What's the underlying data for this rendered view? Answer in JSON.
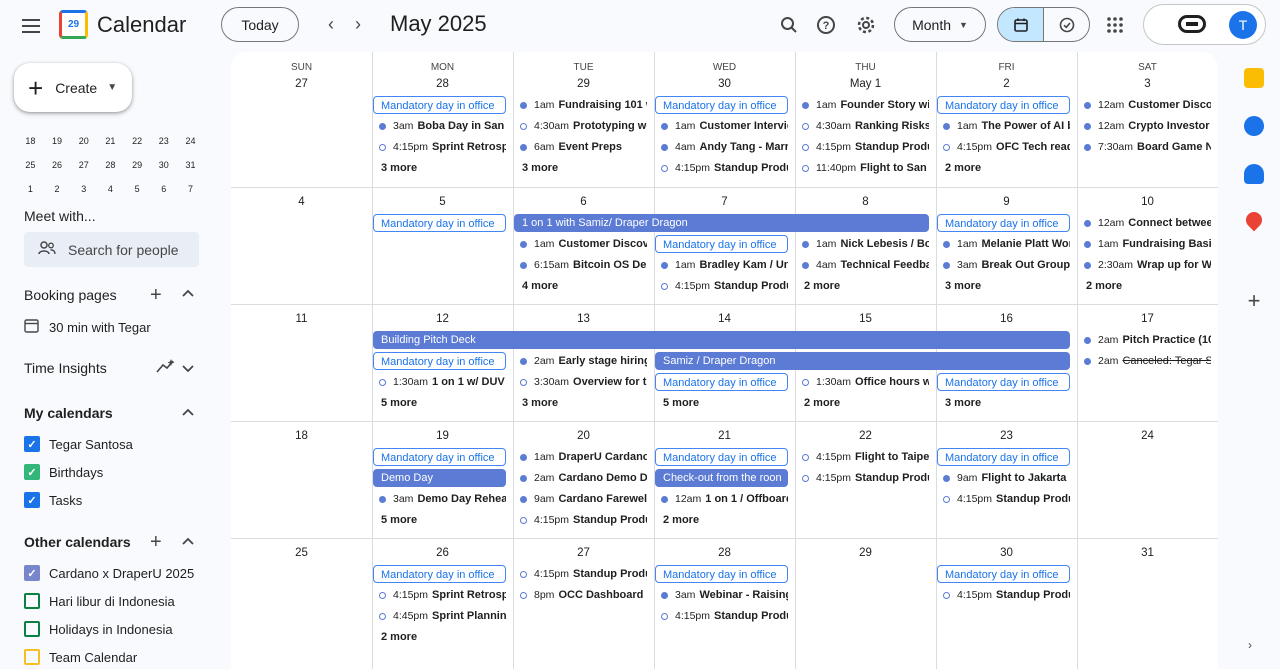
{
  "header": {
    "app_title": "Calendar",
    "logo_text": "29",
    "today_label": "Today",
    "month_title": "May 2025",
    "view_label": "Month",
    "avatar_initial": "T"
  },
  "sidebar": {
    "create_label": "Create",
    "mini_calendar_rows": [
      [
        "18",
        "19",
        "20",
        "21",
        "22",
        "23",
        "24"
      ],
      [
        "25",
        "26",
        "27",
        "28",
        "29",
        "30",
        "31"
      ],
      [
        "1",
        "2",
        "3",
        "4",
        "5",
        "6",
        "7"
      ]
    ],
    "meet_with": "Meet with...",
    "search_people_placeholder": "Search for people",
    "booking_pages": "Booking pages",
    "booking_item": "30 min with Tegar",
    "time_insights": "Time Insights",
    "my_calendars": "My calendars",
    "my_calendar_items": [
      {
        "label": "Tegar Santosa",
        "color": "#1a73e8",
        "checked": true
      },
      {
        "label": "Birthdays",
        "color": "#33b679",
        "checked": true
      },
      {
        "label": "Tasks",
        "color": "#1a73e8",
        "checked": true
      }
    ],
    "other_calendars": "Other calendars",
    "other_calendar_items": [
      {
        "label": "Cardano x DraperU 2025",
        "color": "#7986cb",
        "checked": true
      },
      {
        "label": "Hari libur di Indonesia",
        "color": "#0b8043",
        "checked": false
      },
      {
        "label": "Holidays in Indonesia",
        "color": "#0b8043",
        "checked": false
      },
      {
        "label": "Team Calendar",
        "color": "#f6bf26",
        "checked": false
      }
    ]
  },
  "colors": {
    "accent": "#1a73e8",
    "event_blue": "#5b7bd5",
    "outline_blue": "#4285f4"
  },
  "grid": {
    "weekdays": [
      "SUN",
      "MON",
      "TUE",
      "WED",
      "THU",
      "FRI",
      "SAT"
    ],
    "weeks": [
      {
        "dates": [
          "27",
          "28",
          "29",
          "30",
          "May 1",
          "2",
          "3"
        ],
        "spans": [],
        "cells": [
          {
            "events": [],
            "more": ""
          },
          {
            "events": [
              {
                "kind": "outline",
                "title": "Mandatory day in office"
              },
              {
                "kind": "timed",
                "time": "3am",
                "title": "Boba Day in San M"
              },
              {
                "kind": "timed",
                "hollow": true,
                "time": "4:15pm",
                "title": "Sprint Retrospe"
              }
            ],
            "more": "3 more"
          },
          {
            "events": [
              {
                "kind": "timed",
                "time": "1am",
                "title": "Fundraising 101 wi"
              },
              {
                "kind": "timed",
                "hollow": true,
                "time": "4:30am",
                "title": "Prototyping wo"
              },
              {
                "kind": "timed",
                "time": "6am",
                "title": "Event Preps"
              }
            ],
            "more": "3 more"
          },
          {
            "events": [
              {
                "kind": "outline",
                "title": "Mandatory day in office"
              },
              {
                "kind": "timed",
                "time": "1am",
                "title": "Customer Intervie"
              },
              {
                "kind": "timed",
                "time": "4am",
                "title": "Andy Tang - Marri"
              },
              {
                "kind": "timed",
                "hollow": true,
                "time": "4:15pm",
                "title": "Standup Produc"
              }
            ],
            "more": ""
          },
          {
            "events": [
              {
                "kind": "timed",
                "time": "1am",
                "title": "Founder Story with"
              },
              {
                "kind": "timed",
                "hollow": true,
                "time": "4:30am",
                "title": "Ranking Risks v"
              },
              {
                "kind": "timed",
                "hollow": true,
                "time": "4:15pm",
                "title": "Standup Produc"
              },
              {
                "kind": "timed",
                "hollow": true,
                "time": "11:40pm",
                "title": "Flight to San F"
              }
            ],
            "more": ""
          },
          {
            "events": [
              {
                "kind": "outline",
                "title": "Mandatory day in office"
              },
              {
                "kind": "timed",
                "time": "1am",
                "title": "The Power of AI by"
              },
              {
                "kind": "timed",
                "hollow": true,
                "time": "4:15pm",
                "title": "OFC Tech readi"
              }
            ],
            "more": "2 more"
          },
          {
            "events": [
              {
                "kind": "timed",
                "time": "12am",
                "title": "Customer Discove"
              },
              {
                "kind": "timed",
                "time": "12am",
                "title": "Crypto Investor G"
              },
              {
                "kind": "timed",
                "time": "7:30am",
                "title": "Board Game Ni"
              }
            ],
            "more": ""
          }
        ]
      },
      {
        "dates": [
          "4",
          "5",
          "6",
          "7",
          "8",
          "9",
          "10"
        ],
        "spans": [
          {
            "title": "1 on 1 with Samiz/ Draper Dragon",
            "start": 2,
            "end": 4
          }
        ],
        "cells": [
          {
            "events": [],
            "more": ""
          },
          {
            "events": [
              {
                "kind": "outline",
                "title": "Mandatory day in office"
              }
            ],
            "more": ""
          },
          {
            "events": [
              {
                "kind": "spacer"
              },
              {
                "kind": "timed",
                "time": "1am",
                "title": "Customer Discover"
              },
              {
                "kind": "timed",
                "time": "6:15am",
                "title": "Bitcoin OS Dem"
              }
            ],
            "more": "4 more"
          },
          {
            "events": [
              {
                "kind": "spacer"
              },
              {
                "kind": "outline",
                "title": "Mandatory day in office"
              },
              {
                "kind": "timed",
                "time": "1am",
                "title": "Bradley Kam / Unst"
              },
              {
                "kind": "timed",
                "hollow": true,
                "time": "4:15pm",
                "title": "Standup Produc"
              }
            ],
            "more": ""
          },
          {
            "events": [
              {
                "kind": "spacer"
              },
              {
                "kind": "timed",
                "time": "1am",
                "title": "Nick Lebesis / Boar"
              },
              {
                "kind": "timed",
                "time": "4am",
                "title": "Technical Feedbac"
              }
            ],
            "more": "2 more"
          },
          {
            "events": [
              {
                "kind": "outline",
                "title": "Mandatory day in office"
              },
              {
                "kind": "timed",
                "time": "1am",
                "title": "Melanie Platt Work"
              },
              {
                "kind": "timed",
                "time": "3am",
                "title": "Break Out Groups:"
              }
            ],
            "more": "3 more"
          },
          {
            "events": [
              {
                "kind": "timed",
                "time": "12am",
                "title": "Connect between"
              },
              {
                "kind": "timed",
                "time": "1am",
                "title": "Fundraising Basics"
              },
              {
                "kind": "timed",
                "time": "2:30am",
                "title": "Wrap up for We"
              }
            ],
            "more": "2 more"
          }
        ]
      },
      {
        "dates": [
          "11",
          "12",
          "13",
          "14",
          "15",
          "16",
          "17"
        ],
        "spans": [
          {
            "title": "Building Pitch Deck",
            "start": 1,
            "end": 5,
            "row": 0
          },
          {
            "title": "Samiz / Draper Dragon",
            "start": 3,
            "end": 5,
            "row": 1
          }
        ],
        "cells": [
          {
            "events": [],
            "more": ""
          },
          {
            "events": [
              {
                "kind": "spacer"
              },
              {
                "kind": "outline",
                "title": "Mandatory day in office"
              },
              {
                "kind": "timed",
                "hollow": true,
                "time": "1:30am",
                "title": "1 on 1 w/ DUV Te"
              }
            ],
            "more": "5 more"
          },
          {
            "events": [
              {
                "kind": "spacer"
              },
              {
                "kind": "timed",
                "time": "2am",
                "title": "Early stage hiring c"
              },
              {
                "kind": "timed",
                "hollow": true,
                "time": "3:30am",
                "title": "Overview for th"
              }
            ],
            "more": "3 more"
          },
          {
            "events": [
              {
                "kind": "spacer"
              },
              {
                "kind": "spacer"
              },
              {
                "kind": "outline",
                "title": "Mandatory day in office"
              }
            ],
            "more": "5 more"
          },
          {
            "events": [
              {
                "kind": "spacer"
              },
              {
                "kind": "spacer"
              },
              {
                "kind": "timed",
                "hollow": true,
                "time": "1:30am",
                "title": "Office hours wi"
              }
            ],
            "more": "2 more"
          },
          {
            "events": [
              {
                "kind": "spacer"
              },
              {
                "kind": "spacer"
              },
              {
                "kind": "outline",
                "title": "Mandatory day in office"
              }
            ],
            "more": "3 more"
          },
          {
            "events": [
              {
                "kind": "timed",
                "time": "2am",
                "title": "Pitch Practice (10"
              },
              {
                "kind": "timed",
                "strike": true,
                "time": "2am",
                "title": "Canceled: Tegar Se"
              }
            ],
            "more": ""
          }
        ]
      },
      {
        "dates": [
          "18",
          "19",
          "20",
          "21",
          "22",
          "23",
          "24"
        ],
        "spans": [],
        "cells": [
          {
            "events": [],
            "more": ""
          },
          {
            "events": [
              {
                "kind": "outline",
                "title": "Mandatory day in office"
              },
              {
                "kind": "solid",
                "title": "Demo Day"
              },
              {
                "kind": "timed",
                "time": "3am",
                "title": "Demo Day Rehears"
              }
            ],
            "more": "5 more"
          },
          {
            "events": [
              {
                "kind": "timed",
                "time": "1am",
                "title": "DraperU Cardano E"
              },
              {
                "kind": "timed",
                "time": "2am",
                "title": "Cardano Demo Da"
              },
              {
                "kind": "timed",
                "time": "9am",
                "title": "Cardano Farewell L"
              },
              {
                "kind": "timed",
                "hollow": true,
                "time": "4:15pm",
                "title": "Standup Produc"
              }
            ],
            "more": ""
          },
          {
            "events": [
              {
                "kind": "outline",
                "title": "Mandatory day in office"
              },
              {
                "kind": "solid",
                "title": "Check-out from the roon"
              },
              {
                "kind": "timed",
                "time": "12am",
                "title": "1 on 1 / Offboardir"
              }
            ],
            "more": "2 more"
          },
          {
            "events": [
              {
                "kind": "timed",
                "hollow": true,
                "time": "4:15pm",
                "title": "Flight to Taipei ("
              },
              {
                "kind": "timed",
                "hollow": true,
                "time": "4:15pm",
                "title": "Standup Produc"
              }
            ],
            "more": ""
          },
          {
            "events": [
              {
                "kind": "outline",
                "title": "Mandatory day in office"
              },
              {
                "kind": "timed",
                "time": "9am",
                "title": "Flight to Jakarta (E"
              },
              {
                "kind": "timed",
                "hollow": true,
                "time": "4:15pm",
                "title": "Standup Produc"
              }
            ],
            "more": ""
          },
          {
            "events": [],
            "more": ""
          }
        ]
      },
      {
        "dates": [
          "25",
          "26",
          "27",
          "28",
          "29",
          "30",
          "31"
        ],
        "spans": [],
        "cells": [
          {
            "events": [],
            "more": ""
          },
          {
            "events": [
              {
                "kind": "outline",
                "title": "Mandatory day in office"
              },
              {
                "kind": "timed",
                "hollow": true,
                "time": "4:15pm",
                "title": "Sprint Retrospe"
              },
              {
                "kind": "timed",
                "hollow": true,
                "time": "4:45pm",
                "title": "Sprint Planning"
              }
            ],
            "more": "2 more"
          },
          {
            "events": [
              {
                "kind": "timed",
                "hollow": true,
                "time": "4:15pm",
                "title": "Standup Produc"
              },
              {
                "kind": "timed",
                "hollow": true,
                "time": "8pm",
                "title": "OCC Dashboard p"
              }
            ],
            "more": ""
          },
          {
            "events": [
              {
                "kind": "outline",
                "title": "Mandatory day in office"
              },
              {
                "kind": "timed",
                "time": "3am",
                "title": "Webinar - Raising"
              },
              {
                "kind": "timed",
                "hollow": true,
                "time": "4:15pm",
                "title": "Standup Produc"
              }
            ],
            "more": ""
          },
          {
            "events": [],
            "more": ""
          },
          {
            "events": [
              {
                "kind": "outline",
                "title": "Mandatory day in office"
              },
              {
                "kind": "timed",
                "hollow": true,
                "time": "4:15pm",
                "title": "Standup Produc"
              }
            ],
            "more": ""
          },
          {
            "events": [],
            "more": ""
          }
        ]
      }
    ]
  }
}
